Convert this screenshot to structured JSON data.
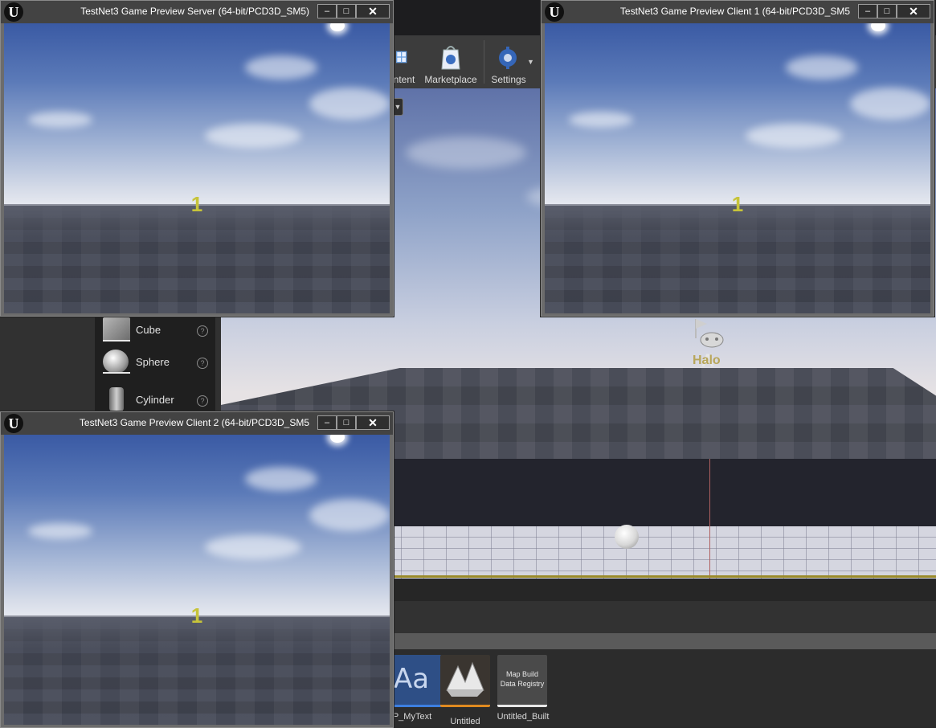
{
  "toolbar": {
    "content_label": "ntent",
    "marketplace_label": "Marketplace",
    "settings_label": "Settings"
  },
  "place_panel": {
    "items": [
      {
        "label": "Cube",
        "help": "?"
      },
      {
        "label": "Sphere",
        "help": "?"
      },
      {
        "label": "Cylinder",
        "help": "?"
      }
    ]
  },
  "viewport": {
    "actor_label": "Halo",
    "actor_glyph": "A"
  },
  "content_browser": {
    "assets": [
      {
        "thumb_text": "Aa",
        "label": "P_MyText"
      },
      {
        "thumb_text": "",
        "label": "Untitled"
      },
      {
        "thumb_text": "Map Build Data Registry",
        "label": "Untitled_Built"
      }
    ]
  },
  "windows": {
    "server": {
      "title": "TestNet3 Game Preview Server (64-bit/PCD3D_SM5)",
      "marker": "1"
    },
    "client1": {
      "title": "TestNet3 Game Preview Client 1 (64-bit/PCD3D_SM5",
      "marker": "1"
    },
    "client2": {
      "title": "TestNet3 Game Preview Client 2 (64-bit/PCD3D_SM5",
      "marker": "1"
    }
  },
  "window_controls": {
    "minimize": "–",
    "maximize": "□",
    "close": "✕"
  },
  "logo_glyph": "U",
  "colors": {
    "marker_yellow": "#c7c43a",
    "title_bar": "#434343",
    "sky_top": "#3a5aa4"
  }
}
